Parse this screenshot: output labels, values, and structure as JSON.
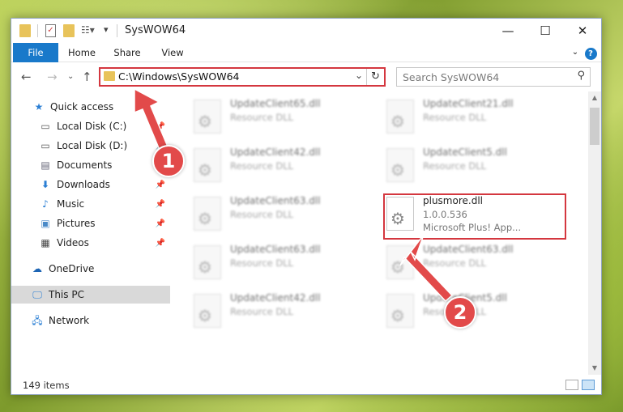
{
  "window": {
    "title": "SysWOW64",
    "controls": {
      "minimize": "—",
      "maximize": "☐",
      "close": "✕"
    }
  },
  "ribbon": {
    "tabs": [
      "File",
      "Home",
      "Share",
      "View"
    ],
    "help": "?"
  },
  "address": {
    "path": "C:\\Windows\\SysWOW64",
    "search_placeholder": "Search SysWOW64"
  },
  "nav": {
    "items": [
      {
        "label": "Quick access",
        "icon": "star-icon",
        "pinned": false
      },
      {
        "label": "Local Disk (C:)",
        "icon": "drive-icon",
        "pinned": true
      },
      {
        "label": "Local Disk (D:)",
        "icon": "drive-icon",
        "pinned": true
      },
      {
        "label": "Documents",
        "icon": "documents-icon",
        "pinned": true
      },
      {
        "label": "Downloads",
        "icon": "downloads-icon",
        "pinned": true
      },
      {
        "label": "Music",
        "icon": "music-icon",
        "pinned": true
      },
      {
        "label": "Pictures",
        "icon": "pictures-icon",
        "pinned": true
      },
      {
        "label": "Videos",
        "icon": "videos-icon",
        "pinned": true
      },
      {
        "label": "OneDrive",
        "icon": "cloud-icon",
        "pinned": false
      },
      {
        "label": "This PC",
        "icon": "computer-icon",
        "pinned": false,
        "selected": true
      },
      {
        "label": "Network",
        "icon": "network-icon",
        "pinned": false
      }
    ]
  },
  "files": [
    {
      "name": "UpdateClient65.dll",
      "type": "Resource DLL",
      "blurred": true
    },
    {
      "name": "UpdateClient21.dll",
      "type": "Resource DLL",
      "blurred": true
    },
    {
      "name": "UpdateClient42.dll",
      "type": "Resource DLL",
      "blurred": true
    },
    {
      "name": "UpdateClient5.dll",
      "type": "Resource DLL",
      "blurred": true
    },
    {
      "name": "UpdateClient63.dll",
      "type": "Resource DLL",
      "blurred": true
    },
    {
      "name": "plusmore.dll",
      "version": "1.0.0.536",
      "type": "Microsoft Plus! App...",
      "blurred": false,
      "highlighted": true
    },
    {
      "name": "UpdateClient63.dll",
      "type": "Resource DLL",
      "blurred": true
    },
    {
      "name": "UpdateClient63.dll",
      "type": "Resource DLL",
      "blurred": true
    },
    {
      "name": "UpdateClient42.dll",
      "type": "Resource DLL",
      "blurred": true
    },
    {
      "name": "UpdateClient5.dll",
      "type": "Resource DLL",
      "blurred": true
    }
  ],
  "status": {
    "item_count": "149 items"
  },
  "annotations": {
    "badge1": "1",
    "badge2": "2",
    "color": "#e24a4a"
  }
}
